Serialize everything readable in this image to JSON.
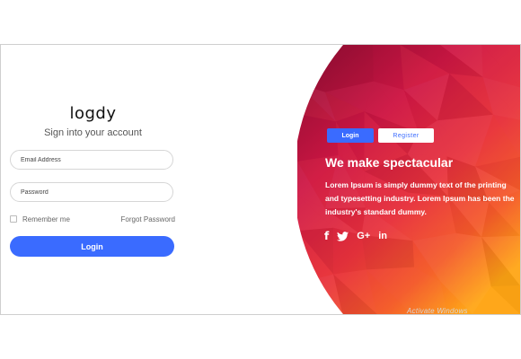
{
  "brand": {
    "logo": "logdy",
    "subtitle": "Sign into your account"
  },
  "form": {
    "email_placeholder": "Email Address",
    "password_placeholder": "Password",
    "remember_label": "Remember me",
    "forgot_label": "Forgot Password",
    "login_button": "Login"
  },
  "panel": {
    "tabs": {
      "login": "Login",
      "register": "Register"
    },
    "headline": "We make spectacular",
    "body": "Lorem Ipsum is simply dummy text of the printing and typesetting industry. Lorem Ipsum has been the industry's standard dummy.",
    "social": {
      "facebook": "f",
      "google_plus": "G+",
      "linkedin": "in"
    }
  },
  "watermark": "Activate Windows",
  "colors": {
    "accent": "#3a6bff",
    "panel_top": "#a8103a",
    "panel_mid": "#d41a45",
    "panel_bottom": "#ff9a1a"
  },
  "icons": [
    "facebook-icon",
    "twitter-icon",
    "google-plus-icon",
    "linkedin-icon",
    "checkbox-icon"
  ]
}
